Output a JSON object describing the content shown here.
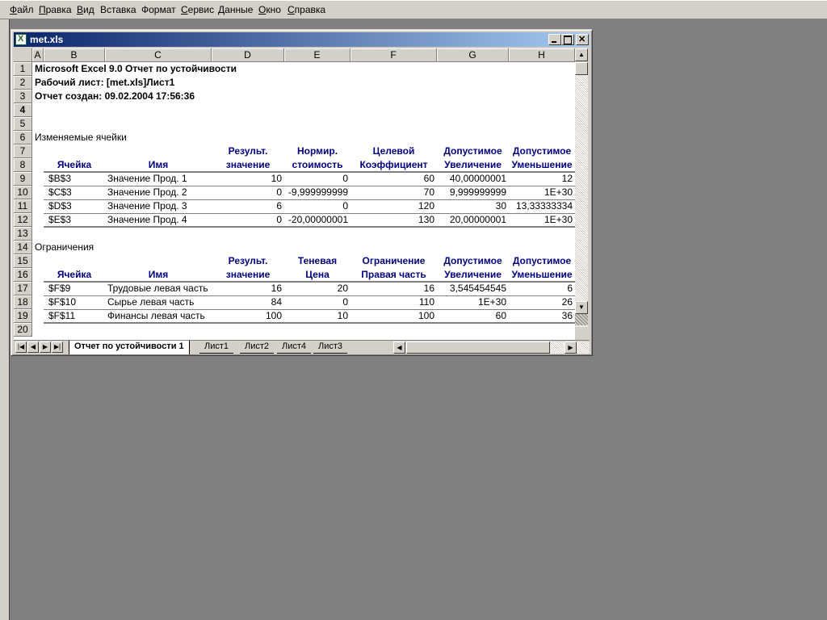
{
  "menu": [
    {
      "label": "Файл",
      "u": "Ф",
      "rest": "айл"
    },
    {
      "label": "Правка",
      "u": "П",
      "rest": "равка"
    },
    {
      "label": "Вид",
      "u": "В",
      "rest": "ид"
    },
    {
      "label": "Вставка",
      "u": "",
      "rest": "Вставка"
    },
    {
      "label": "Формат",
      "u": "",
      "rest": "Формат"
    },
    {
      "label": "Сервис",
      "u": "С",
      "rest": "ервис"
    },
    {
      "label": "Данные",
      "u": "Д",
      "rest": "анные"
    },
    {
      "label": "Окно",
      "u": "О",
      "rest": "кно"
    },
    {
      "label": "Справка",
      "u": "С",
      "rest": "правка"
    }
  ],
  "window": {
    "title": "met.xls"
  },
  "columns": [
    "A",
    "B",
    "C",
    "D",
    "E",
    "F",
    "G",
    "H"
  ],
  "rows": [
    "1",
    "2",
    "3",
    "4",
    "5",
    "6",
    "7",
    "8",
    "9",
    "10",
    "11",
    "12",
    "13",
    "14",
    "15",
    "16",
    "17",
    "18",
    "19",
    "20"
  ],
  "active_row": "4",
  "report": {
    "title": "Microsoft Excel 9.0 Отчет по устойчивости",
    "sheet": "Рабочий лист: [met.xls]Лист1",
    "created": "Отчет создан: 09.02.2004 17:56:36"
  },
  "changing": {
    "section_title": "Изменяемые ячейки",
    "header_top": [
      "",
      "",
      "Результ.",
      "Нормир.",
      "Целевой",
      "Допустимое",
      "Допустимое"
    ],
    "header_bottom": [
      "Ячейка",
      "Имя",
      "значение",
      "стоимость",
      "Коэффициент",
      "Увеличение",
      "Уменьшение"
    ],
    "rows": [
      [
        "$B$3",
        "Значение Прод. 1",
        "10",
        "0",
        "60",
        "40,00000001",
        "12"
      ],
      [
        "$C$3",
        "Значение Прод. 2",
        "0",
        "-9,999999999",
        "70",
        "9,999999999",
        "1E+30"
      ],
      [
        "$D$3",
        "Значение Прод. 3",
        "6",
        "0",
        "120",
        "30",
        "13,33333334"
      ],
      [
        "$E$3",
        "Значение Прод. 4",
        "0",
        "-20,00000001",
        "130",
        "20,00000001",
        "1E+30"
      ]
    ]
  },
  "constraints": {
    "section_title": "Ограничения",
    "header_top": [
      "",
      "",
      "Результ.",
      "Теневая",
      "Ограничение",
      "Допустимое",
      "Допустимое"
    ],
    "header_bottom": [
      "Ячейка",
      "Имя",
      "значение",
      "Цена",
      "Правая часть",
      "Увеличение",
      "Уменьшение"
    ],
    "rows": [
      [
        "$F$9",
        "Трудовые  левая часть",
        "16",
        "20",
        "16",
        "3,545454545",
        "6"
      ],
      [
        "$F$10",
        "Сырье левая часть",
        "84",
        "0",
        "110",
        "1E+30",
        "26"
      ],
      [
        "$F$11",
        "Финансы левая часть",
        "100",
        "10",
        "100",
        "60",
        "36"
      ]
    ]
  },
  "tabs": [
    "Отчет по устойчивости 1",
    "Лист1",
    "Лист2",
    "Лист4",
    "Лист3"
  ],
  "active_tab": 0
}
